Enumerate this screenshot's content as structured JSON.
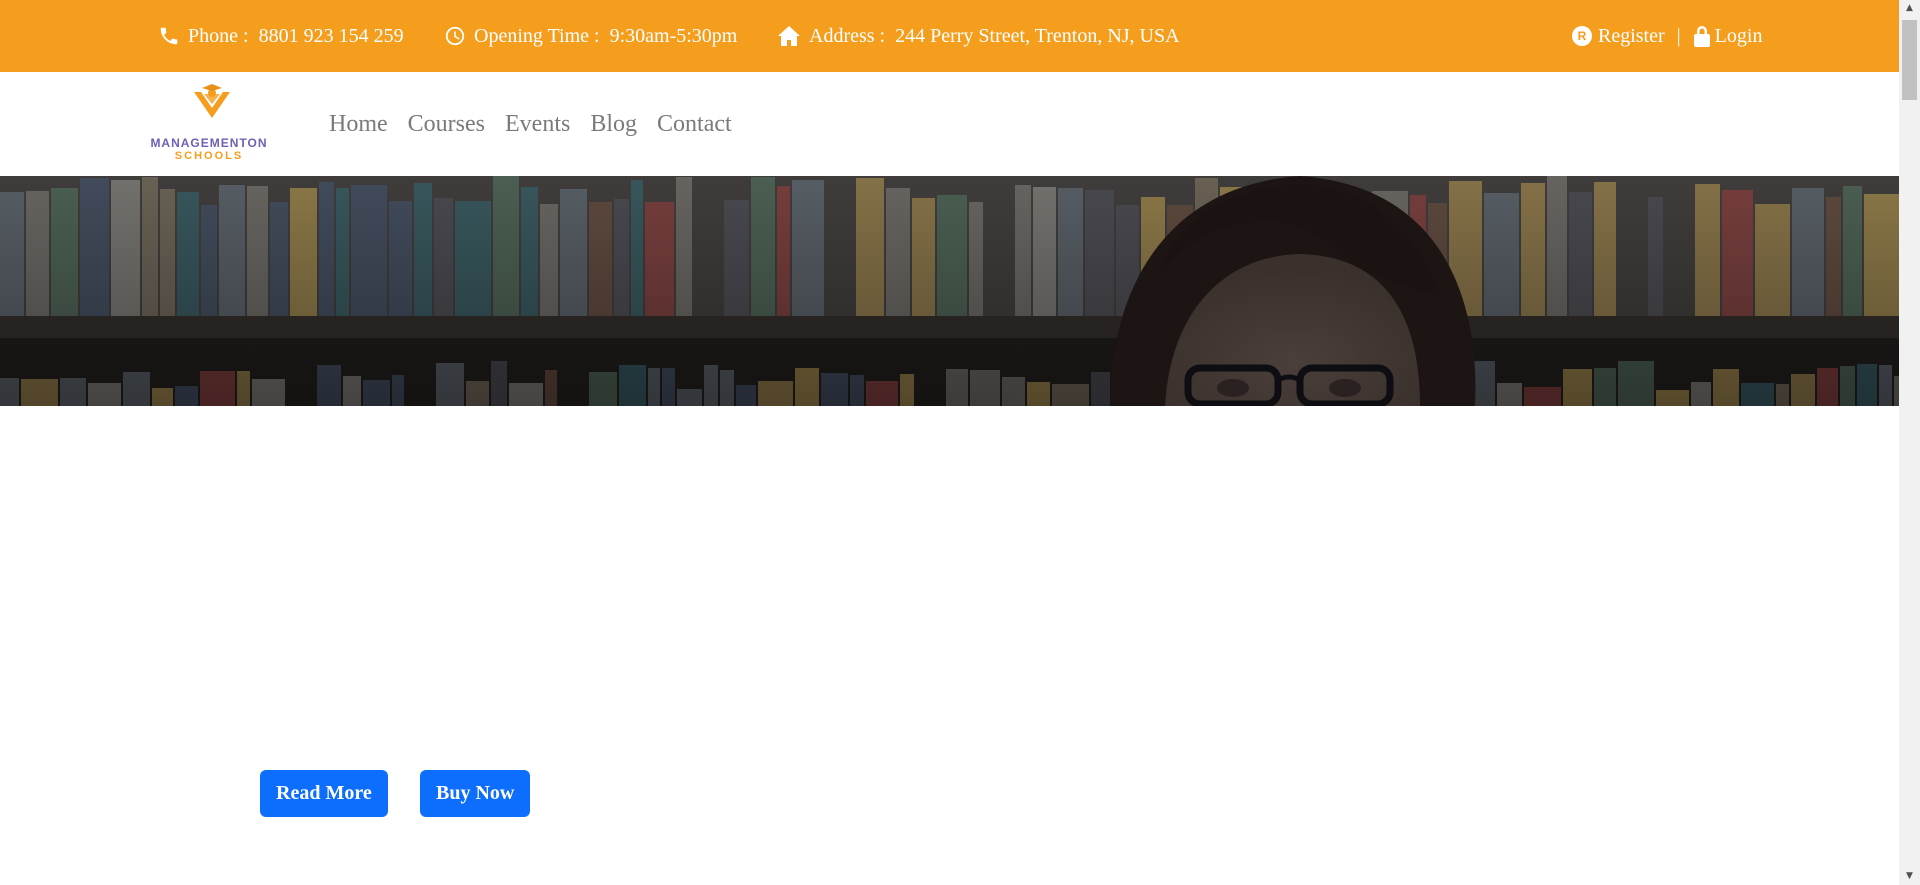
{
  "topbar": {
    "phone_label": "Phone :",
    "phone_value": "8801 923 154 259",
    "hours_label": "Opening Time :",
    "hours_value": "9:30am-5:30pm",
    "address_label": "Address :",
    "address_value": "244 Perry Street, Trenton, NJ, USA",
    "register_badge": "R",
    "register_label": "Register",
    "separator": "|",
    "login_label": "Login",
    "icons": [
      "phone-icon",
      "clock-icon",
      "home-icon",
      "register-icon",
      "lock-icon"
    ]
  },
  "brand": {
    "name_line1": "MANAGEMENTON",
    "name_line2": "SCHOOLS",
    "colors": {
      "primary": "#6f5fb5",
      "accent": "#f59e1d"
    }
  },
  "nav": {
    "items": [
      {
        "label": "Home"
      },
      {
        "label": "Courses"
      },
      {
        "label": "Events"
      },
      {
        "label": "Blog"
      },
      {
        "label": "Contact"
      }
    ]
  },
  "hero": {
    "background": "library-bookshelf-woman-with-glasses"
  },
  "buttons": {
    "read_more": "Read More",
    "buy_now": "Buy Now",
    "color": "#0d6efd"
  },
  "scrollbar": {
    "up_arrow": "▲",
    "down_arrow": "▼"
  }
}
